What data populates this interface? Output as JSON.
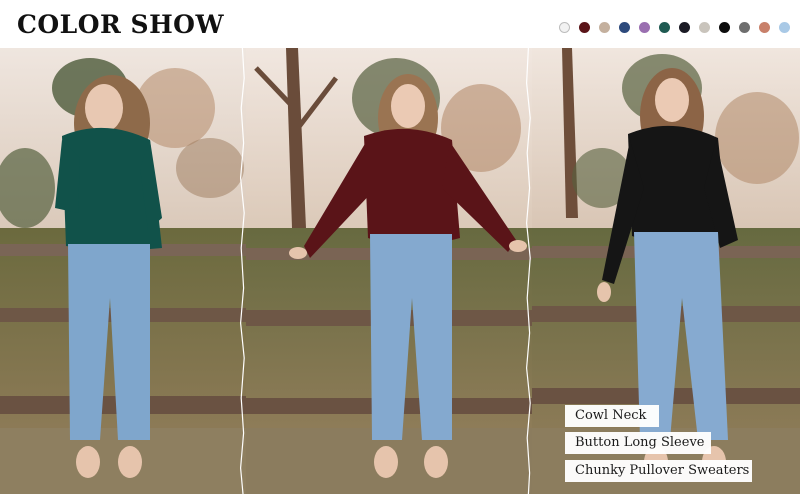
{
  "header": {
    "title": "COLOR SHOW"
  },
  "swatches": [
    {
      "name": "white",
      "color": "#f2f2f2"
    },
    {
      "name": "burgundy",
      "color": "#5a1418"
    },
    {
      "name": "beige",
      "color": "#c4b09e"
    },
    {
      "name": "navy",
      "color": "#2d4a7c"
    },
    {
      "name": "purple",
      "color": "#9a6fb0"
    },
    {
      "name": "dark-green",
      "color": "#1f5a52"
    },
    {
      "name": "black",
      "color": "#1a1a24"
    },
    {
      "name": "light-grey",
      "color": "#c9c4bc"
    },
    {
      "name": "deep-black",
      "color": "#0d0d0d"
    },
    {
      "name": "grey",
      "color": "#6e6e6e"
    },
    {
      "name": "rust",
      "color": "#c8806a"
    },
    {
      "name": "light-blue",
      "color": "#a9c9e6"
    }
  ],
  "models": [
    {
      "sweater_color": "#11524a",
      "jeans_color": "#7fa6cc"
    },
    {
      "sweater_color": "#5a1418",
      "jeans_color": "#84a9cf"
    },
    {
      "sweater_color": "#151515",
      "jeans_color": "#86aad0"
    }
  ],
  "captions": {
    "feature_1": "Cowl Neck",
    "feature_2": "Button Long Sleeve",
    "feature_3": "Chunky Pullover Sweaters"
  }
}
